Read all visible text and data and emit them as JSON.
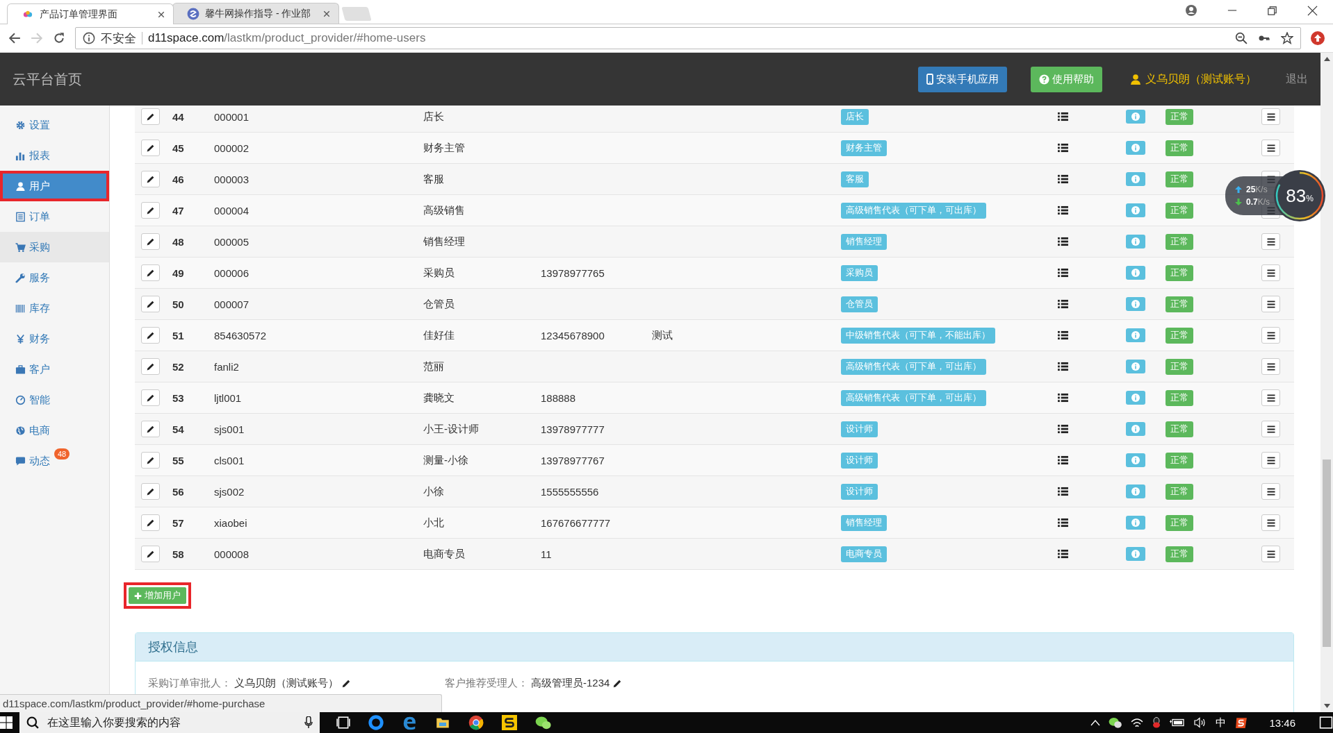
{
  "browser": {
    "tabs": [
      {
        "title": "产品订单管理界面",
        "selected": true
      },
      {
        "title": "馨牛网操作指导 - 作业部",
        "selected": false
      }
    ],
    "forward_disabled": true,
    "security": "不安全",
    "url_host": "d11space.com",
    "url_path": "/lastkm/product_provider/#home-users"
  },
  "header": {
    "brand": "云平台首页",
    "buttons": [
      {
        "label": "安装手机应用",
        "kind": "primary"
      },
      {
        "label": "使用帮助",
        "kind": "success"
      }
    ],
    "user": "义乌贝朗（测试账号）",
    "logout": "退出"
  },
  "sidebar": {
    "items": [
      {
        "label": "设置",
        "selected": false,
        "hovered": false,
        "highlighted": false
      },
      {
        "label": "报表",
        "selected": false,
        "hovered": false,
        "highlighted": false
      },
      {
        "label": "用户",
        "selected": true,
        "hovered": false,
        "highlighted": true
      },
      {
        "label": "订单",
        "selected": false,
        "hovered": false,
        "highlighted": false
      },
      {
        "label": "采购",
        "selected": false,
        "hovered": true,
        "highlighted": false
      },
      {
        "label": "服务",
        "selected": false,
        "hovered": false,
        "highlighted": false
      },
      {
        "label": "库存",
        "selected": false,
        "hovered": false,
        "highlighted": false
      },
      {
        "label": "财务",
        "selected": false,
        "hovered": false,
        "highlighted": false
      },
      {
        "label": "客户",
        "selected": false,
        "hovered": false,
        "highlighted": false
      },
      {
        "label": "智能",
        "selected": false,
        "hovered": false,
        "highlighted": false
      },
      {
        "label": "电商",
        "selected": false,
        "hovered": false,
        "highlighted": false
      },
      {
        "label": "动态",
        "selected": false,
        "hovered": false,
        "highlighted": false,
        "badge": "48"
      }
    ]
  },
  "table": {
    "rows": [
      {
        "no": "44",
        "account": "000001",
        "name": "店长",
        "role": "店长",
        "status": "正常"
      },
      {
        "no": "45",
        "account": "000002",
        "name": "财务主管",
        "role": "财务主管",
        "status": "正常"
      },
      {
        "no": "46",
        "account": "000003",
        "name": "客服",
        "role": "客服",
        "status": "正常"
      },
      {
        "no": "47",
        "account": "000004",
        "name": "高级销售",
        "role": "高级销售代表（可下单，可出库）",
        "status": "正常"
      },
      {
        "no": "48",
        "account": "000005",
        "name": "销售经理",
        "role": "销售经理",
        "status": "正常"
      },
      {
        "no": "49",
        "account": "000006",
        "name": "采购员",
        "phone": "13978977765",
        "role": "采购员",
        "status": "正常"
      },
      {
        "no": "50",
        "account": "000007",
        "name": "仓管员",
        "role": "仓管员",
        "status": "正常"
      },
      {
        "no": "51",
        "account": "854630572",
        "name": "佳好佳",
        "phone": "12345678900",
        "note": "测试",
        "role": "中级销售代表（可下单，不能出库）",
        "status": "正常"
      },
      {
        "no": "52",
        "account": "fanli2",
        "name": "范丽",
        "role": "高级销售代表（可下单，可出库）",
        "status": "正常"
      },
      {
        "no": "53",
        "account": "ljtl001",
        "name": "龚晓文",
        "phone": "188888",
        "role": "高级销售代表（可下单，可出库）",
        "status": "正常"
      },
      {
        "no": "54",
        "account": "sjs001",
        "name": "小王-设计师",
        "phone": "13978977777",
        "role": "设计师",
        "status": "正常"
      },
      {
        "no": "55",
        "account": "cls001",
        "name": "测量-小徐",
        "phone": "13978977767",
        "role": "设计师",
        "status": "正常"
      },
      {
        "no": "56",
        "account": "sjs002",
        "name": "小徐",
        "phone": "1555555556",
        "role": "设计师",
        "status": "正常"
      },
      {
        "no": "57",
        "account": "xiaobei",
        "name": "小北",
        "phone": "167676677777",
        "role": "销售经理",
        "status": "正常"
      },
      {
        "no": "58",
        "account": "000008",
        "name": "电商专员",
        "phone": "11",
        "role": "电商专员",
        "status": "正常"
      }
    ]
  },
  "add_button": {
    "label": "增加用户",
    "highlighted": true
  },
  "auth": {
    "title": "授权信息",
    "fields": [
      {
        "label": "采购订单审批人：",
        "value": "义乌贝朗（测试账号）"
      },
      {
        "label": "客户推荐受理人：",
        "value": "高级管理员-1234"
      }
    ]
  },
  "status_url": "d11space.com/lastkm/product_provider/#home-purchase",
  "net_widget": {
    "up": "25",
    "up_unit": "K/s",
    "down": "0.7",
    "down_unit": "K/s",
    "percent": "83",
    "percent_unit": "%"
  },
  "taskbar": {
    "search_placeholder": "在这里输入你要搜索的内容",
    "ime": "中",
    "time": "13:46"
  }
}
